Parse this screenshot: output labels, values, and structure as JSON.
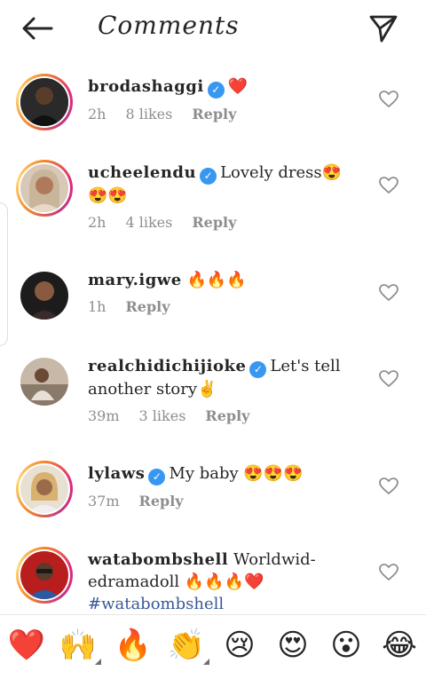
{
  "header": {
    "title": "Comments"
  },
  "comments": [
    {
      "username": "brodashaggi",
      "verified": true,
      "text": "❤️",
      "time": "2h",
      "likes": "8 likes",
      "reply": "Reply"
    },
    {
      "username": "ucheelendu",
      "verified": true,
      "text": "Lovely dress😍😍😍",
      "time": "2h",
      "likes": "4 likes",
      "reply": "Reply"
    },
    {
      "username": "mary.igwe",
      "verified": false,
      "text": "🔥🔥🔥",
      "time": "1h",
      "likes": "",
      "reply": "Reply"
    },
    {
      "username": "realchidichijioke",
      "verified": true,
      "text": "Let's tell another story✌️",
      "time": "39m",
      "likes": "3 likes",
      "reply": "Reply"
    },
    {
      "username": "lylaws",
      "verified": true,
      "text": "My baby 😍😍😍",
      "time": "37m",
      "likes": "",
      "reply": "Reply"
    },
    {
      "username": "watabombshell",
      "verified": false,
      "text": "Worldwid-edramadoll 🔥🔥🔥❤️",
      "hashtag": "#watabombshell",
      "time": "",
      "likes": "",
      "reply": ""
    }
  ],
  "emoji_bar": [
    "❤️",
    "🙌",
    "🔥",
    "👏",
    "😢",
    "😍",
    "😮",
    "😂"
  ],
  "colors": {
    "verified": "#3897f0",
    "hashtag": "#385898",
    "meta": "#8e8e8e",
    "heart_emoji": "#e0245e"
  }
}
